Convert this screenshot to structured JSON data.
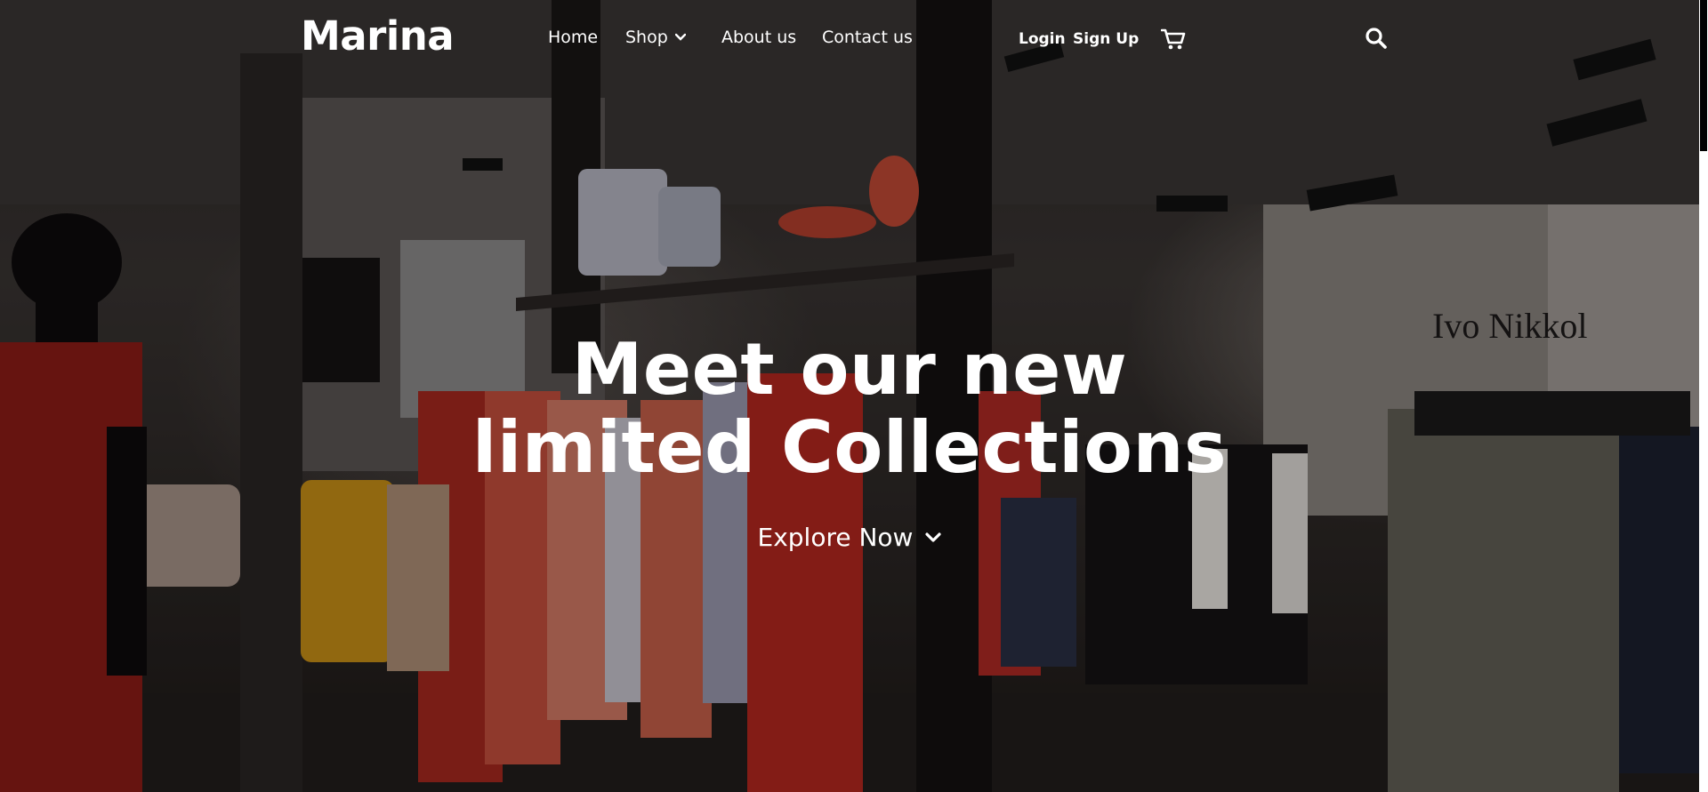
{
  "brand": {
    "logo": "Marina"
  },
  "nav": {
    "links": [
      "Home",
      "Shop",
      "About us",
      "Contact us"
    ],
    "login": "Login",
    "signup": "Sign Up"
  },
  "icons": {
    "shop_dropdown": "chevron-down-icon",
    "cart": "cart-icon",
    "search": "search-icon",
    "explore": "chevron-down-icon"
  },
  "hero": {
    "headline_line1": "Meet our new",
    "headline_line2": "limited Collections",
    "cta": "Explore Now"
  },
  "colors": {
    "text": "#ffffff",
    "overlay": "#000000"
  }
}
